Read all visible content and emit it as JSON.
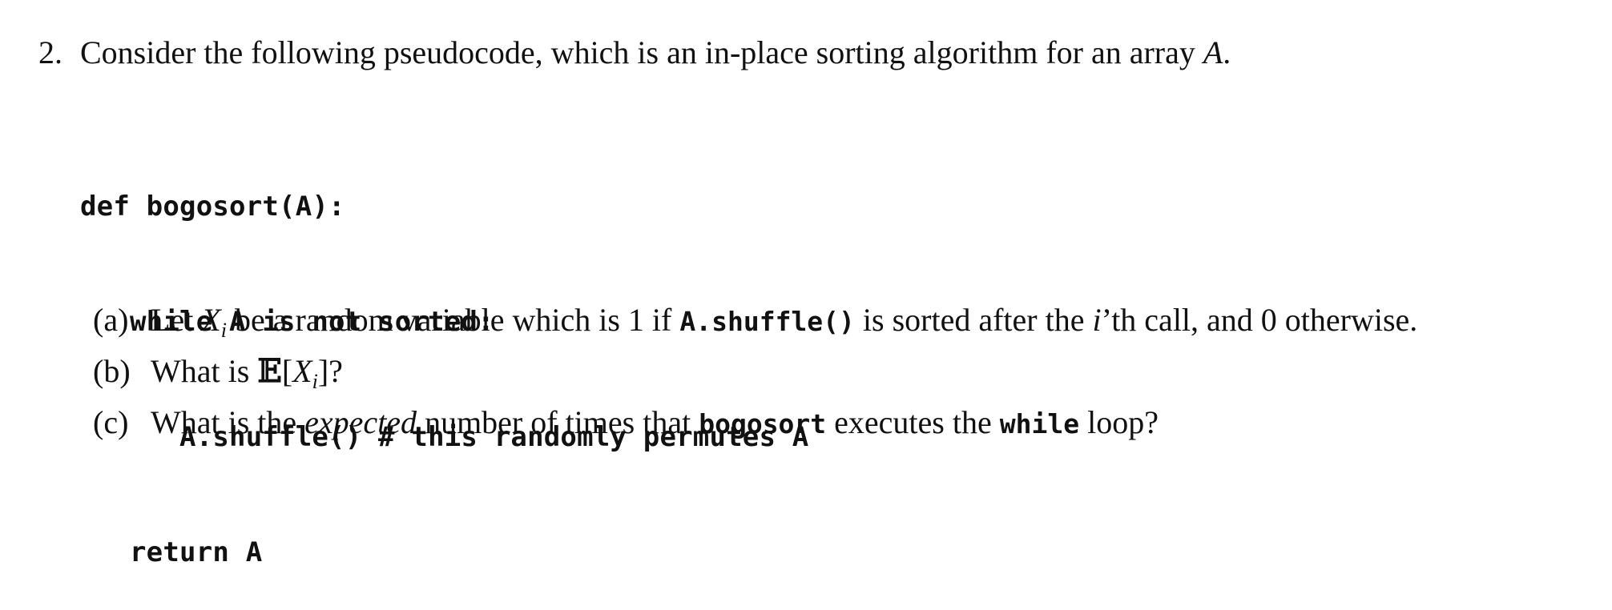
{
  "problem": {
    "number": "2.",
    "statement_prefix": "Consider the following pseudocode, which is an in-place sorting algorithm for an array ",
    "statement_var": "A",
    "statement_suffix": "."
  },
  "code": {
    "line1": "def bogosort(A):",
    "line2": "   while A is not sorted:",
    "line3": "      A.shuffle() # this randomly permutes A",
    "line4": "   return A"
  },
  "subparts": {
    "a": {
      "label": "(a)",
      "text_1": "Let ",
      "var": "X",
      "var_sub": "i",
      "text_2": " be a random variable which is 1 if ",
      "code": "A.shuffle()",
      "text_3": " is sorted after the ",
      "var_i": "i",
      "text_4": "’th call, and 0 otherwise."
    },
    "b": {
      "label": "(b)",
      "text_1": "What is ",
      "expectation": "𝔼",
      "bracket_open": "[",
      "var": "X",
      "var_sub": "i",
      "bracket_close": "]?"
    },
    "c": {
      "label": "(c)",
      "text_1": "What is the ",
      "emph": "expected",
      "text_2": " number of times that ",
      "code_1": "bogosort",
      "text_3": " executes the ",
      "code_2": "while",
      "text_4": " loop?"
    }
  }
}
